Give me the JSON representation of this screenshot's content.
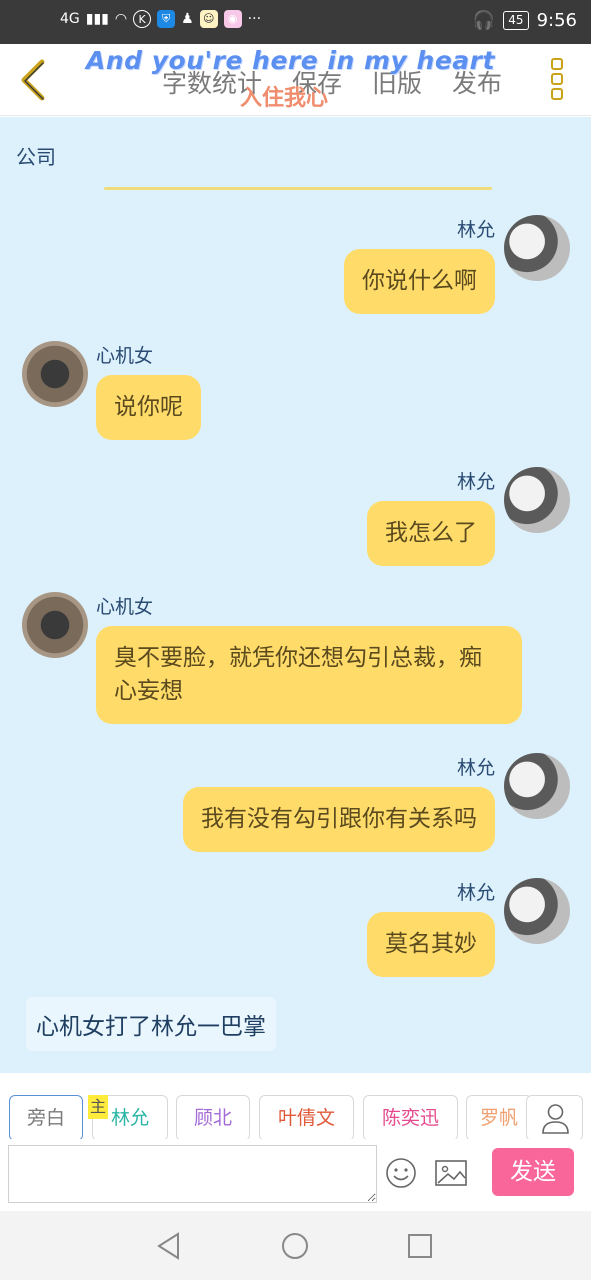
{
  "status": {
    "network": "4G",
    "battery": "45",
    "time": "9:56",
    "more": "···"
  },
  "header": {
    "tabs": [
      "字数统计",
      "保存",
      "旧版",
      "发布"
    ],
    "overlay_en": "And you're here in my heart",
    "overlay_cn": "入住我心"
  },
  "chat": {
    "topic": "公司",
    "messages": [
      {
        "side": "right",
        "name": "林允",
        "text": "你说什么啊"
      },
      {
        "side": "left",
        "name": "心机女",
        "text": "说你呢"
      },
      {
        "side": "right",
        "name": "林允",
        "text": "我怎么了"
      },
      {
        "side": "left",
        "name": "心机女",
        "text": "臭不要脸，就凭你还想勾引总裁，痴心妄想"
      },
      {
        "side": "right",
        "name": "林允",
        "text": "我有没有勾引跟你有关系吗"
      },
      {
        "side": "right",
        "name": "林允",
        "text": "莫名其妙"
      }
    ],
    "narration": "心机女打了林允一巴掌"
  },
  "roles": {
    "items": [
      {
        "label": "旁白",
        "color": "#7a7a7a"
      },
      {
        "label": "林允",
        "color": "#2bb5a6"
      },
      {
        "label": "顾北",
        "color": "#a46ad6"
      },
      {
        "label": "叶倩文",
        "color": "#e05a3a"
      },
      {
        "label": "陈奕迅",
        "color": "#e64a8e"
      },
      {
        "label": "罗帆",
        "color": "#f0a070"
      }
    ],
    "main_tag": "主"
  },
  "input": {
    "placeholder": "",
    "send_label": "发送"
  }
}
